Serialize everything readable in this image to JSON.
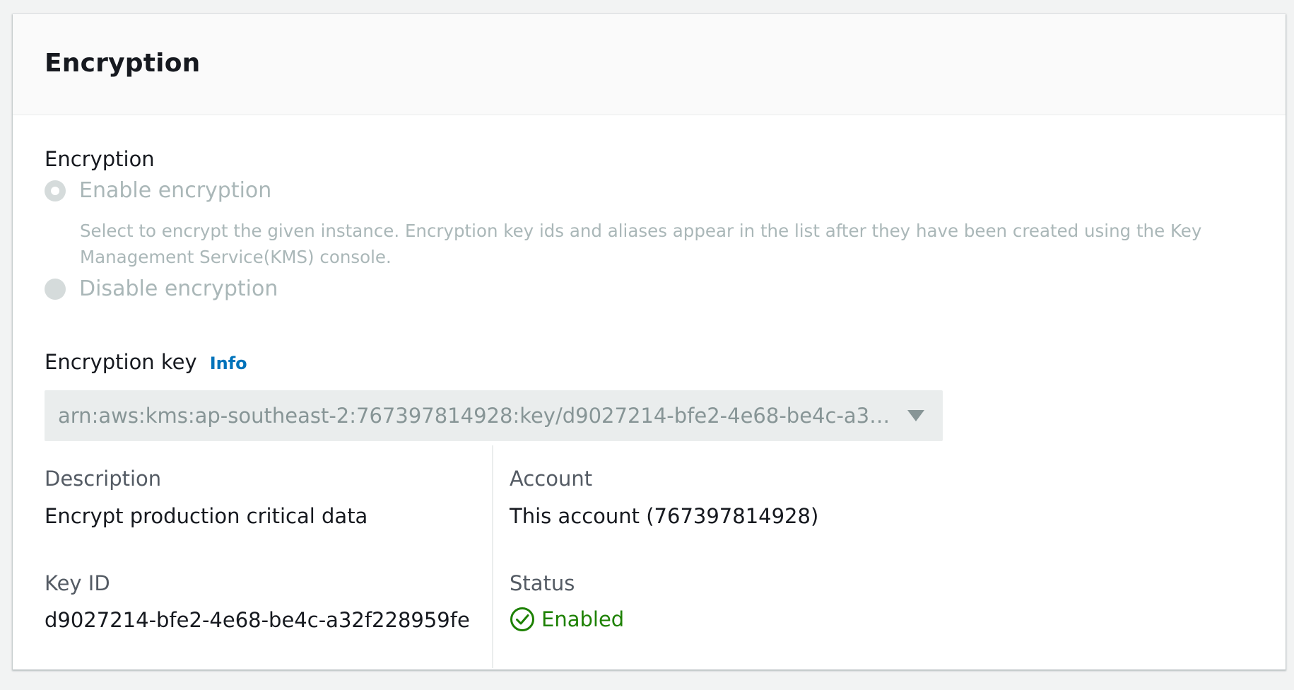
{
  "panel": {
    "title": "Encryption"
  },
  "encryption_group": {
    "label": "Encryption",
    "options": [
      {
        "label": "Enable encryption",
        "description": "Select to encrypt the given instance. Encryption key ids and aliases appear in the list after they have been created using the Key Management Service(KMS) console.",
        "selected": true,
        "disabled": true
      },
      {
        "label": "Disable encryption",
        "selected": false,
        "disabled": true
      }
    ]
  },
  "encryption_key": {
    "label": "Encryption key",
    "info_link": "Info",
    "selected_value": "arn:aws:kms:ap-southeast-2:767397814928:key/d9027214-bfe2-4e68-be4c-a3…"
  },
  "key_details": {
    "description_label": "Description",
    "description_value": "Encrypt production critical data",
    "account_label": "Account",
    "account_value": "This account (767397814928)",
    "key_id_label": "Key ID",
    "key_id_value": "d9027214-bfe2-4e68-be4c-a32f228959fe",
    "status_label": "Status",
    "status_value": "Enabled",
    "status_color": "#1d8102",
    "status_icon": "check-circle-icon"
  },
  "colors": {
    "link": "#0073bb",
    "disabled_text": "#aab7b8",
    "select_bg": "#eaeded"
  }
}
